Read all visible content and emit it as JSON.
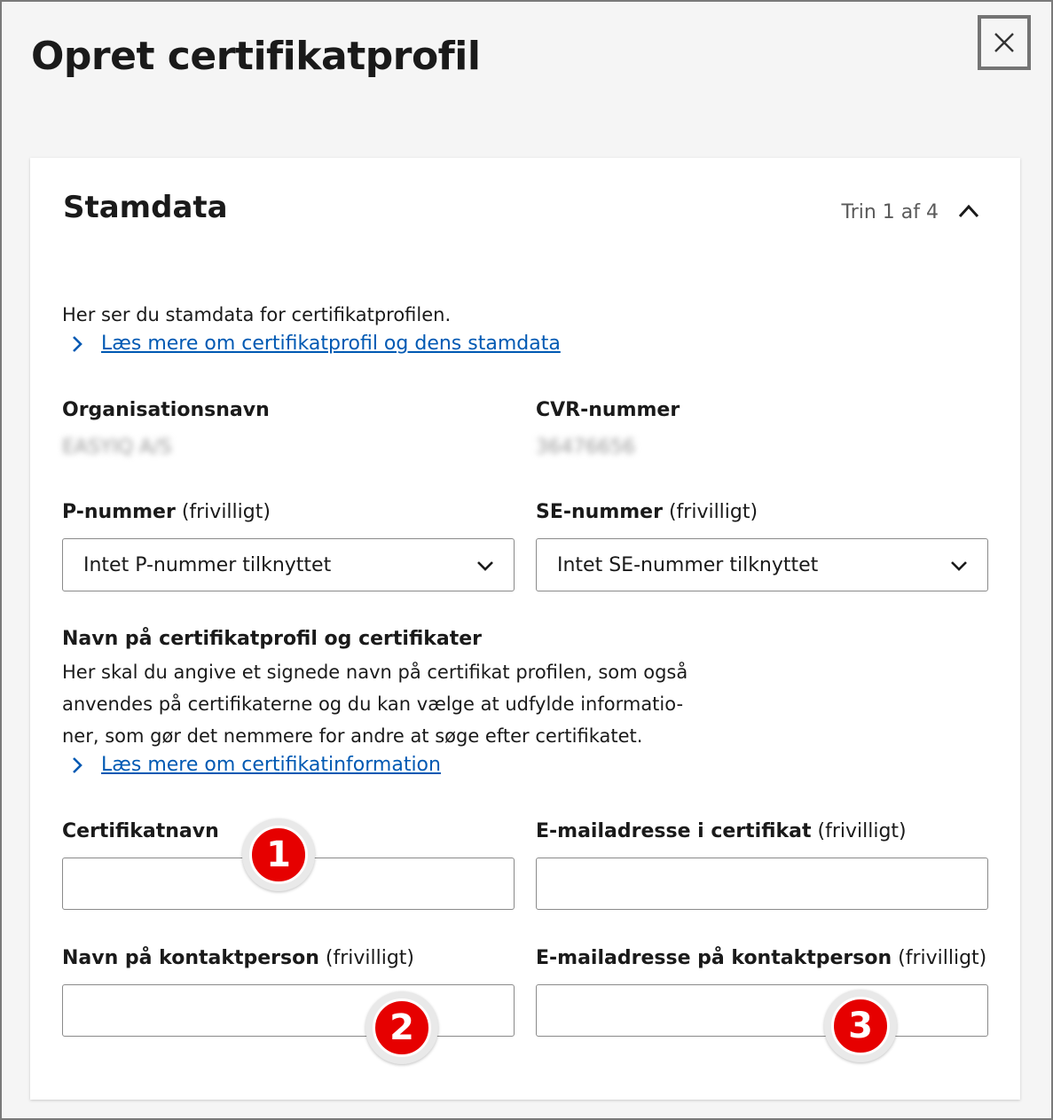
{
  "dialog": {
    "title": "Opret certifikatprofil",
    "close_icon": "close-icon"
  },
  "section": {
    "title": "Stamdata",
    "step": "Trin 1 af 4",
    "collapse_icon": "chevron-up-icon"
  },
  "intro": {
    "text": "Her ser du stamdata for certifikatprofilen.",
    "link": "Læs mere om certifikatprofil og dens stamdata"
  },
  "org": {
    "name_label": "Organisationsnavn",
    "name_value": "EASYIQ A/S",
    "cvr_label": "CVR-nummer",
    "cvr_value": "36476656"
  },
  "p_number": {
    "label": "P-nummer",
    "optional": "(frivilligt)",
    "value": "Intet P-nummer tilknyttet"
  },
  "se_number": {
    "label": "SE-nummer",
    "optional": "(frivilligt)",
    "value": "Intet SE-nummer tilknyttet"
  },
  "cert_info": {
    "heading": "Navn på certifikatprofil og certifikater",
    "line1": "Her skal du angive et signede navn på certifikat profilen, som også",
    "line2": "anvendes på certifikaterne og du kan vælge at udfylde informatio-",
    "line3": "ner, som gør det nemmere for andre at søge efter certifikatet.",
    "link": "Læs mere om certifikatinformation"
  },
  "fields": {
    "cert_name_label": "Certifikatnavn",
    "cert_email_label": "E-mailadresse i certifikat",
    "cert_email_optional": "(frivilligt)",
    "contact_name_label": "Navn på kontaktperson",
    "contact_name_optional": "(frivilligt)",
    "contact_email_label": "E-mailadresse på kontaktperson",
    "contact_email_optional": "(frivilligt)"
  },
  "badges": [
    "1",
    "2",
    "3"
  ],
  "colors": {
    "link": "#0059b3",
    "badge": "#e60000"
  }
}
